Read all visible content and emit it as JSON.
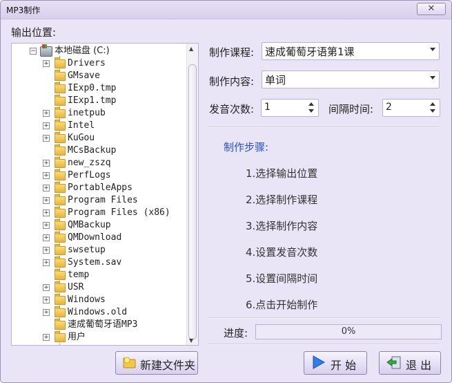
{
  "window": {
    "title": "MP3制作",
    "close_label": "✕"
  },
  "output": {
    "label": "输出位置:"
  },
  "tree": {
    "drive": "本地磁盘 (C:)",
    "items": [
      {
        "label": "Drivers",
        "expandable": true
      },
      {
        "label": "GMsave",
        "expandable": false
      },
      {
        "label": "IExp0.tmp",
        "expandable": false
      },
      {
        "label": "IExp1.tmp",
        "expandable": false
      },
      {
        "label": "inetpub",
        "expandable": true
      },
      {
        "label": "Intel",
        "expandable": true
      },
      {
        "label": "KuGou",
        "expandable": true
      },
      {
        "label": "MCsBackup",
        "expandable": false
      },
      {
        "label": "new_zszq",
        "expandable": true
      },
      {
        "label": "PerfLogs",
        "expandable": true
      },
      {
        "label": "PortableApps",
        "expandable": true
      },
      {
        "label": "Program Files",
        "expandable": true
      },
      {
        "label": "Program Files (x86)",
        "expandable": true
      },
      {
        "label": "QMBackup",
        "expandable": true
      },
      {
        "label": "QMDownload",
        "expandable": true
      },
      {
        "label": "swsetup",
        "expandable": true
      },
      {
        "label": "System.sav",
        "expandable": true
      },
      {
        "label": "temp",
        "expandable": false
      },
      {
        "label": "USR",
        "expandable": true
      },
      {
        "label": "Windows",
        "expandable": true
      },
      {
        "label": "Windows.old",
        "expandable": true
      },
      {
        "label": "速成葡萄牙语MP3",
        "expandable": false
      },
      {
        "label": "用户",
        "expandable": true
      }
    ]
  },
  "form": {
    "course_label": "制作课程:",
    "course_value": "速成葡萄牙语第1课",
    "content_label": "制作内容:",
    "content_value": "单词",
    "repeat_label": "发音次数:",
    "repeat_value": "1",
    "interval_label": "间隔时间:",
    "interval_value": "2"
  },
  "steps": {
    "title": "制作步骤:",
    "items": [
      "1.选择输出位置",
      "2.选择制作课程",
      "3.选择制作内容",
      "4.设置发音次数",
      "5.设置间隔时间",
      "6.点击开始制作"
    ]
  },
  "progress": {
    "label": "进度:",
    "value": 0,
    "text": "0%"
  },
  "buttons": {
    "new_folder": "新建文件夹",
    "start": "开 始",
    "exit": "退 出"
  }
}
